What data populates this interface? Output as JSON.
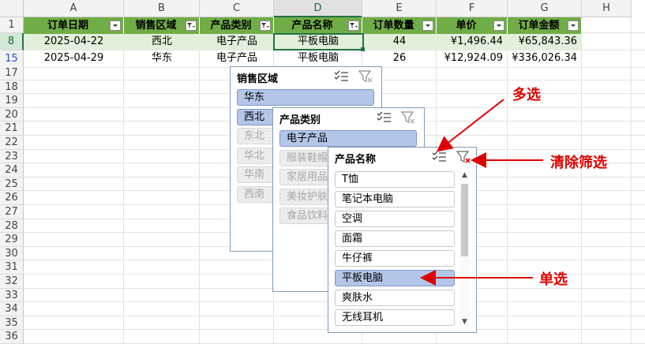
{
  "columns": [
    "A",
    "B",
    "C",
    "D",
    "E",
    "F",
    "G",
    "H"
  ],
  "row_numbers": [
    "1",
    "8",
    "15",
    "17",
    "18",
    "19",
    "20",
    "21",
    "22",
    "23",
    "24",
    "25",
    "26",
    "27",
    "28",
    "29",
    "30",
    "31",
    "32",
    "33",
    "34",
    "35",
    "36"
  ],
  "table": {
    "headers": [
      "订单日期",
      "销售区域",
      "产品类别",
      "产品名称",
      "订单数量",
      "单价",
      "订单金额"
    ],
    "rows": [
      [
        "2025-04-22",
        "西北",
        "电子产品",
        "平板电脑",
        "44",
        "¥1,496.44",
        "¥65,843.36"
      ],
      [
        "2025-04-29",
        "华东",
        "电子产品",
        "平板电脑",
        "26",
        "¥12,924.09",
        "¥336,026.34"
      ]
    ]
  },
  "slicers": {
    "region": {
      "title": "销售区域",
      "items": [
        {
          "label": "华东",
          "state": "selected"
        },
        {
          "label": "西北",
          "state": "selected"
        },
        {
          "label": "东北",
          "state": "off"
        },
        {
          "label": "华北",
          "state": "off"
        },
        {
          "label": "华南",
          "state": "off"
        },
        {
          "label": "西南",
          "state": "off"
        }
      ]
    },
    "category": {
      "title": "产品类别",
      "items": [
        {
          "label": "电子产品",
          "state": "selected"
        },
        {
          "label": "服装鞋帽",
          "state": "off"
        },
        {
          "label": "家居用品",
          "state": "off"
        },
        {
          "label": "美妆护肤",
          "state": "off"
        },
        {
          "label": "食品饮料",
          "state": "off"
        }
      ]
    },
    "product": {
      "title": "产品名称",
      "items": [
        {
          "label": "T恤",
          "state": "available"
        },
        {
          "label": "笔记本电脑",
          "state": "available"
        },
        {
          "label": "空调",
          "state": "available"
        },
        {
          "label": "面霜",
          "state": "available"
        },
        {
          "label": "牛仔裤",
          "state": "available"
        },
        {
          "label": "平板电脑",
          "state": "selected"
        },
        {
          "label": "爽肤水",
          "state": "available"
        },
        {
          "label": "无线耳机",
          "state": "available"
        }
      ]
    }
  },
  "annotations": {
    "multi_select": "多选",
    "clear_filter": "清除筛选",
    "single_select": "单选"
  },
  "icons": {
    "multi_select": "multi-select-icon",
    "clear_filter": "clear-filter-icon",
    "dropdown": "dropdown-arrow-icon",
    "filter_active": "filter-active-icon"
  },
  "colors": {
    "header_green": "#71ad47",
    "row_highlight": "#e2efda",
    "slicer_selected": "#b4c6e7",
    "annotation_red": "#e00000",
    "excel_green": "#217346"
  }
}
